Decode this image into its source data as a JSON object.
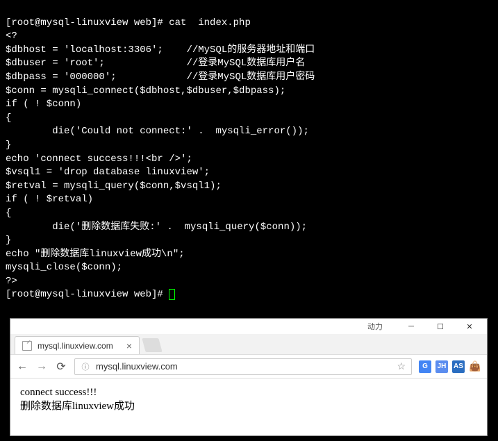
{
  "terminal": {
    "prompt1": "[root@mysql-linuxview web]# cat  index.php",
    "lines": [
      "<?",
      "$dbhost = 'localhost:3306';    //MySQL的服务器地址和端口",
      "$dbuser = 'root';              //登录MySQL数据库用户名",
      "$dbpass = '000000';            //登录MySQL数据库用户密码",
      "$conn = mysqli_connect($dbhost,$dbuser,$dbpass);",
      "if ( ! $conn)",
      "{",
      "        die('Could not connect:' .  mysqli_error());",
      "}",
      "echo 'connect success!!!<br />';",
      "$vsql1 = 'drop database linuxview';",
      "$retval = mysqli_query($conn,$vsql1);",
      "if ( ! $retval)",
      "{",
      "        die('删除数据库失败:' .  mysqli_query($conn));",
      "}",
      "echo \"删除数据库linuxview成功\\n\";",
      "mysqli_close($conn);",
      "?>"
    ],
    "prompt2": "[root@mysql-linuxview web]# "
  },
  "browser": {
    "titlebar_text": "动力",
    "tab": {
      "title": "mysql.linuxview.com"
    },
    "url": "mysql.linuxview.com",
    "ext_labels": {
      "translate": "G",
      "jh": "JH",
      "as": "AS",
      "jar": "👜"
    },
    "page": {
      "line1": "connect success!!!",
      "line2": "删除数据库linuxview成功"
    }
  }
}
